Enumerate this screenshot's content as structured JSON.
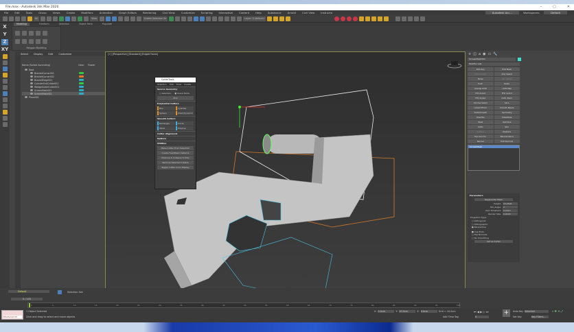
{
  "window": {
    "title": "File.max - Autodesk 3ds Max 2020",
    "min": "–",
    "max": "▢",
    "close": "✕"
  },
  "menu": {
    "items": [
      "File",
      "Edit",
      "Tools",
      "Group",
      "Views",
      "Create",
      "Modifiers",
      "Animation",
      "Graph Editors",
      "Rendering",
      "Civil View",
      "Customize",
      "Scripting",
      "Interactive",
      "Content",
      "Help",
      "Substance",
      "Arnold",
      "Civil View",
      "Instructo"
    ],
    "user": "Autodesk Acc...",
    "workspaces_label": "Workspaces:",
    "workspace": "Default"
  },
  "toolbar": {
    "filter": "All",
    "view": "View",
    "named_sel": "Create Selection Se",
    "layer": "Layer: 0 (default)"
  },
  "ribbon": {
    "tabs": [
      "Modeling",
      "Freeform",
      "Selection",
      "Object Paint",
      "Populate"
    ],
    "panel": "Polygon Modeling"
  },
  "axes": [
    "X",
    "Y",
    "Z",
    "XY"
  ],
  "explorer": {
    "menu": [
      "Select",
      "Display",
      "Edit",
      "Customize"
    ],
    "col_name": "Name (Sorted Ascending)",
    "col_color": "Color",
    "col_frozen": "Frozen",
    "rows": [
      {
        "name": "Root",
        "color": ""
      },
      {
        "name": "BracketCorner001",
        "color": "#2ecc40"
      },
      {
        "name": "BracketCorner002",
        "color": "#e07b2a"
      },
      {
        "name": "BracketEdge001",
        "color": "#2ab0c8"
      },
      {
        "name": "CylinderEndCutter001",
        "color": "#2ecc40"
      },
      {
        "name": "WedgeGuideCutter001",
        "color": "#2ab0c8"
      },
      {
        "name": "ScreenMesh001",
        "color": "#2ab0c8"
      },
      {
        "name": "ScreenMesh002",
        "color": "#2ab0c8"
      },
      {
        "name": "Plane001",
        "color": ""
      }
    ]
  },
  "viewport": {
    "label": "[+] [Perspective] [Standard] [Edged Faces]"
  },
  "dialog": {
    "title": "CutterTools",
    "tabs": [
      "Selection",
      "Edit",
      "Tools",
      "Create"
    ],
    "source": "Source Geometry",
    "radio1": "Selection",
    "radio2": "Scene Node",
    "pick": "Pick",
    "poly": "Polyhedral Cutters",
    "poly_items": [
      "Box",
      "Cylinder",
      "Sphere",
      "Prism/Pyramid"
    ],
    "smooth": "Smooth Cutters",
    "smooth_items": [
      "Rectangle",
      "Circle",
      "Wave",
      "Polyline"
    ],
    "align": "Cutter Alignment",
    "options": "Options",
    "util": "Utilities",
    "util_items": [
      "Make Cutter From Selection",
      "Create Feet/Mesh Instance",
      "Cleanup & Collapse to Poly",
      "Remove Selected Cutters",
      "Toggle Cutter Color Display"
    ]
  },
  "command": {
    "tabs": [
      "+",
      "◫",
      "⌂",
      "◉",
      "▭",
      "🔧"
    ],
    "object_name": "ScreenMesh001",
    "object_color": "#3ee0d0",
    "modifier_list": "Modifier List",
    "modifiers": [
      "Edit Poly",
      "Edit Mesh",
      "Mesh Select",
      "Poly Select",
      "Noise",
      "Vol. Select",
      "Push",
      "Relax",
      "Unwrap UVW",
      "UVW Map",
      "FFD 2x2x2",
      "FFD 3x3x3",
      "FFD 4x4x4",
      "UVW Xform",
      "Volume Select",
      "Slice",
      "Linked XForm",
      "Smooth Ripple",
      "TurboSmooth",
      "Symmetry",
      "Chamfer",
      "Substitute",
      "Shell",
      "Optimize",
      "Cloth",
      "Skin",
      "Surface",
      "Displace",
      "Hair and Fur",
      "Bend/Unbend",
      "Normal",
      "Edit Normals"
    ],
    "stack_item": "ScreenMesh",
    "params": {
      "title": "Parameters",
      "regen": "Regenerate Mesh",
      "height_label": "Height:",
      "height": "10.2500",
      "minangle_label": "Min Angle:",
      "minangle": "0",
      "void_label": "Void Threshold:",
      "void": "0.0010",
      "render_label": "Render Size:",
      "render": "0.0100",
      "proj": "Projection Type:",
      "proj_opts": [
        "Orthogonal",
        "Orthographic",
        "Perspective"
      ],
      "cap": "Cap Ends",
      "flip": "Flip Normals",
      "nosmooth": "No Smoothing",
      "set": "Set as Cutter"
    }
  },
  "bottom": {
    "layer": "Default",
    "selection_set": "Selection Set:",
    "frame": "0 / 100",
    "ticks": [
      "0",
      "5",
      "10",
      "15",
      "20",
      "25",
      "30",
      "35",
      "40",
      "45",
      "50",
      "55",
      "60",
      "65",
      "70",
      "75",
      "80",
      "85",
      "90",
      "95",
      "100"
    ],
    "maxscript": "MAXScript Mi",
    "status1": "1 Object Selected",
    "status2": "Click and drag to select and move objects",
    "x_label": "X:",
    "x": "0.0cm",
    "y_label": "Y:",
    "y": "10.0cm",
    "z_label": "Z:",
    "z": "0.0cm",
    "grid": "Grid = 10.0cm",
    "time_tag": "Add Time Tag",
    "autokey": "Auto Key",
    "setkey": "Set Key",
    "selected": "Selected",
    "keyfilters": "Key Filters...",
    "frame_field": "0"
  }
}
